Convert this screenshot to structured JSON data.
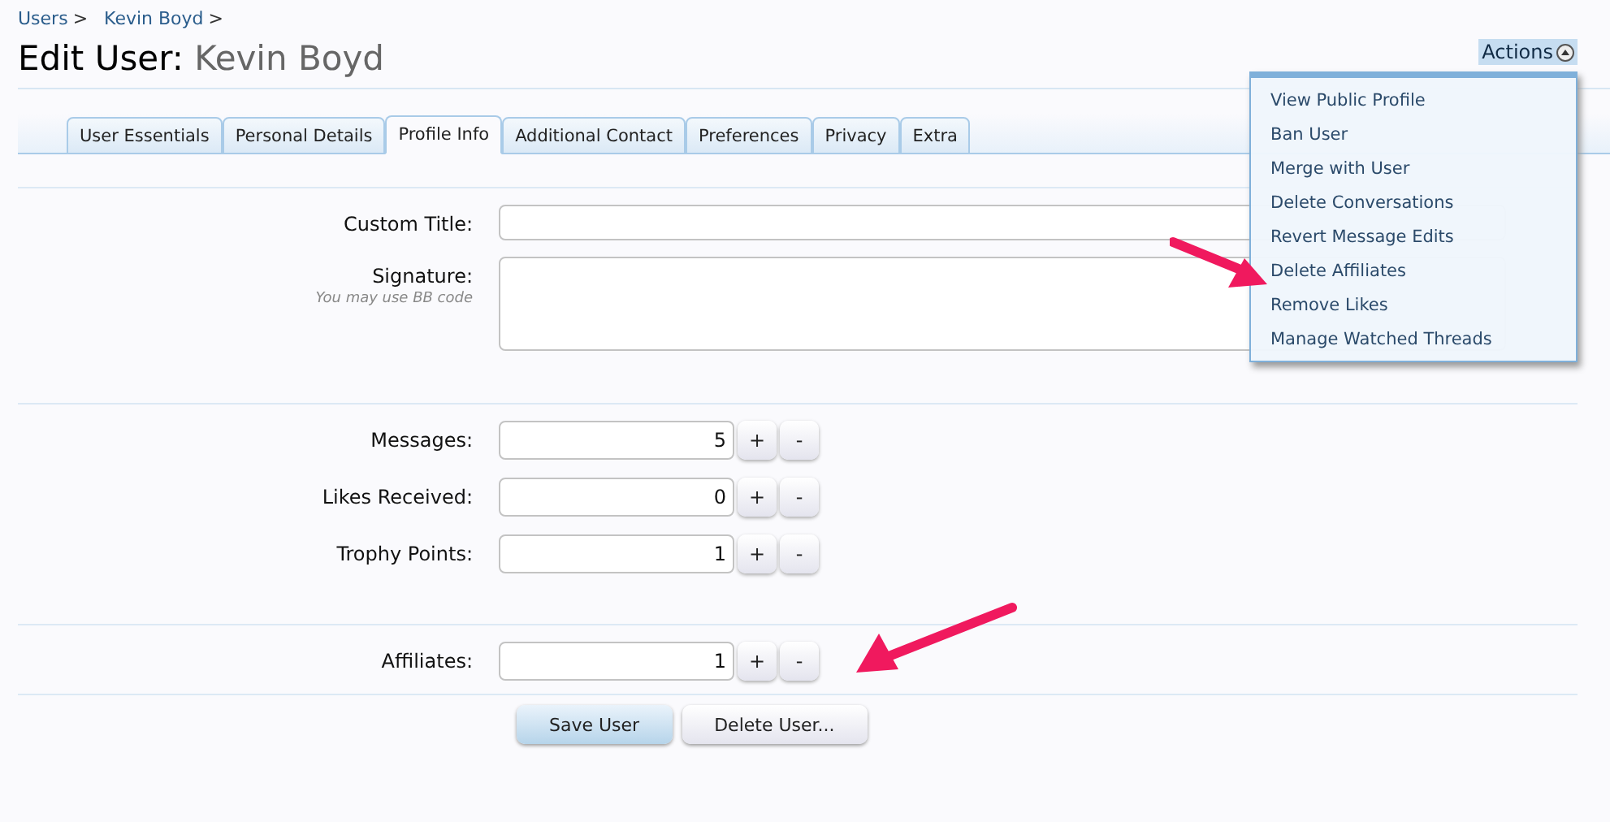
{
  "breadcrumbs": [
    "Users",
    "Kevin Boyd"
  ],
  "breadcrumb_separator": ">",
  "title": {
    "prefix": "Edit User:",
    "name": "Kevin Boyd"
  },
  "actions": {
    "label": "Actions",
    "expanded": true,
    "items": [
      "View Public Profile",
      "Ban User",
      "Merge with User",
      "Delete Conversations",
      "Revert Message Edits",
      "Delete Affiliates",
      "Remove Likes",
      "Manage Watched Threads"
    ]
  },
  "tabs": [
    {
      "label": "User Essentials",
      "selected": false
    },
    {
      "label": "Personal Details",
      "selected": false
    },
    {
      "label": "Profile Info",
      "selected": true
    },
    {
      "label": "Additional Contact",
      "selected": false
    },
    {
      "label": "Preferences",
      "selected": false
    },
    {
      "label": "Privacy",
      "selected": false
    },
    {
      "label": "Extra",
      "selected": false
    }
  ],
  "text_fields": [
    {
      "kind": "line",
      "label": "Custom Title:"
    },
    {
      "kind": "area",
      "label": "Signature:",
      "hint": "You may use BB code"
    }
  ],
  "counters": [
    {
      "label": "Messages:",
      "value": "5"
    },
    {
      "label": "Likes Received:",
      "value": "0"
    },
    {
      "label": "Trophy Points:",
      "value": "1"
    }
  ],
  "affiliates": {
    "label": "Affiliates:",
    "value": "1"
  },
  "counter_buttons": {
    "plus": "+",
    "minus": "-"
  },
  "buttons": [
    {
      "label": "Save User",
      "kind": "primary"
    },
    {
      "label": "Delete User...",
      "kind": "secondary"
    }
  ]
}
